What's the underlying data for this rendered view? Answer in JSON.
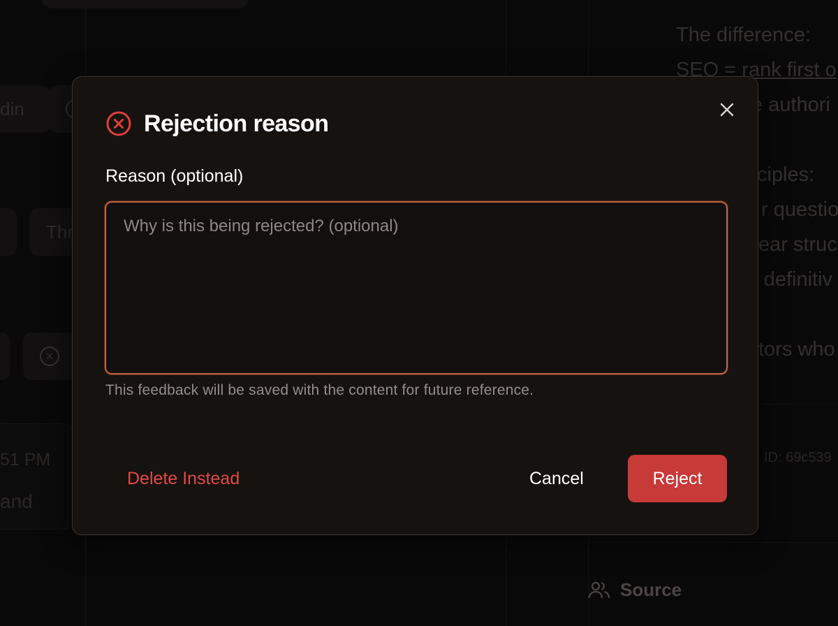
{
  "background": {
    "chip_texts": [
      "din",
      "Thr"
    ],
    "card_time": "51 PM",
    "card_text": "and",
    "right_panel_lines": [
      "The difference:",
      "SEO = rank first o",
      "e authori",
      "ciples:",
      "r questio",
      "ear struc",
      "- definitiv",
      "tors who"
    ],
    "id_text": "ID: 69c539",
    "source_label": "Source",
    "source_icon": "users-icon"
  },
  "modal": {
    "title": "Rejection reason",
    "title_icon": "x-circle-icon",
    "close_icon": "close-icon",
    "field_label": "Reason (optional)",
    "field_value": "",
    "field_placeholder": "Why is this being rejected? (optional)",
    "helper_text": "This feedback will be saved with the content for future reference.",
    "delete_label": "Delete Instead",
    "cancel_label": "Cancel",
    "reject_label": "Reject"
  },
  "colors": {
    "accent_red": "#c73a38",
    "danger_text": "#e04a45",
    "input_focus_border": "#c4623c",
    "modal_background": "#161210"
  }
}
